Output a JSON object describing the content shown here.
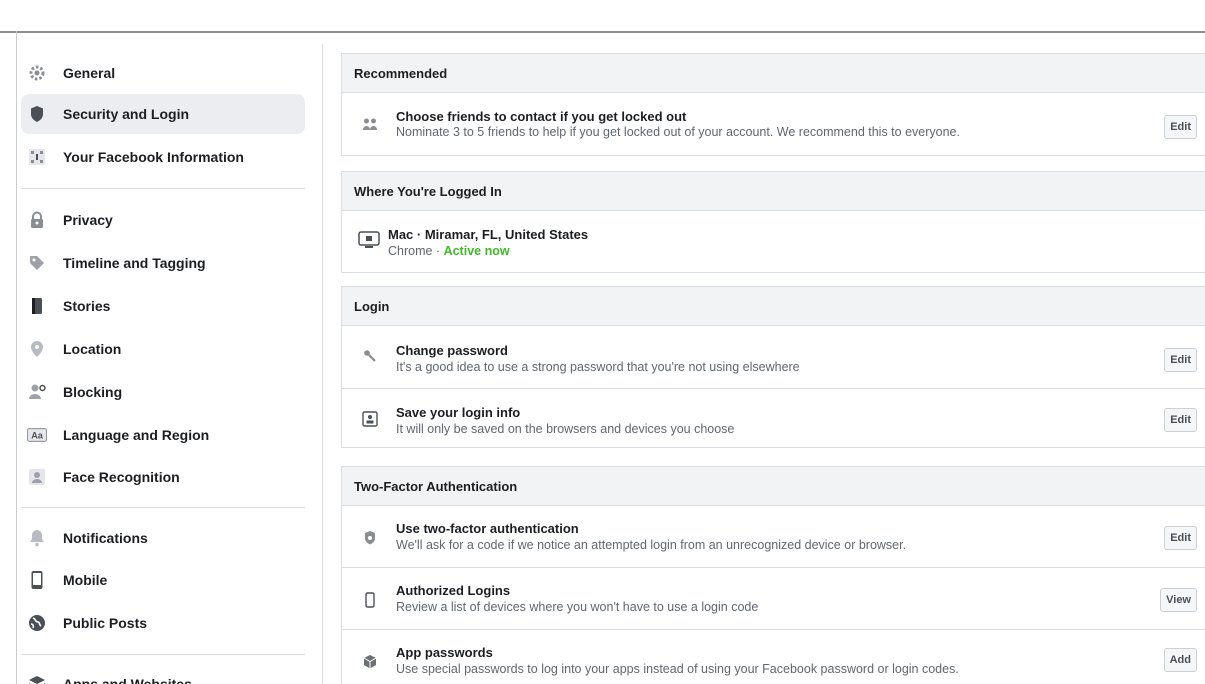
{
  "sidebar": {
    "items": [
      {
        "label": "General",
        "icon": "gear-icon"
      },
      {
        "label": "Security and Login",
        "icon": "shield-icon",
        "active": true
      },
      {
        "label": "Your Facebook Information",
        "icon": "facebook-info-icon"
      },
      {
        "label": "Privacy",
        "icon": "lock-icon"
      },
      {
        "label": "Timeline and Tagging",
        "icon": "tag-icon"
      },
      {
        "label": "Stories",
        "icon": "book-icon"
      },
      {
        "label": "Location",
        "icon": "location-pin-icon"
      },
      {
        "label": "Blocking",
        "icon": "blocking-icon"
      },
      {
        "label": "Language and Region",
        "icon": "language-icon"
      },
      {
        "label": "Face Recognition",
        "icon": "face-recognition-icon"
      },
      {
        "label": "Notifications",
        "icon": "bell-icon"
      },
      {
        "label": "Mobile",
        "icon": "mobile-icon"
      },
      {
        "label": "Public Posts",
        "icon": "globe-icon"
      },
      {
        "label": "Apps and Websites",
        "icon": "apps-icon"
      }
    ]
  },
  "sections": {
    "recommended": {
      "title": "Recommended",
      "rows": [
        {
          "title": "Choose friends to contact if you get locked out",
          "subtitle": "Nominate 3 to 5 friends to help if you get locked out of your account. We recommend this to everyone.",
          "button": "Edit"
        }
      ]
    },
    "logged_in": {
      "title": "Where You're Logged In",
      "device": "Mac · Miramar, FL, United States",
      "browser": "Chrome · ",
      "status": "Active now"
    },
    "login": {
      "title": "Login",
      "rows": [
        {
          "title": "Change password",
          "subtitle": "It's a good idea to use a strong password that you're not using elsewhere",
          "button": "Edit"
        },
        {
          "title": "Save your login info",
          "subtitle": "It will only be saved on the browsers and devices you choose",
          "button": "Edit"
        }
      ]
    },
    "two_factor": {
      "title": "Two-Factor Authentication",
      "rows": [
        {
          "title": "Use two-factor authentication",
          "subtitle": "We'll ask for a code if we notice an attempted login from an unrecognized device or browser.",
          "button": "Edit"
        },
        {
          "title": "Authorized Logins",
          "subtitle": "Review a list of devices where you won't have to use a login code",
          "button": "View"
        },
        {
          "title": "App passwords",
          "subtitle": "Use special passwords to log into your apps instead of using your Facebook password or login codes.",
          "button": "Add"
        }
      ]
    }
  },
  "colors": {
    "active_green": "#42b72a",
    "section_bg": "#f2f3f5",
    "active_nav_bg": "#ebedf0"
  }
}
